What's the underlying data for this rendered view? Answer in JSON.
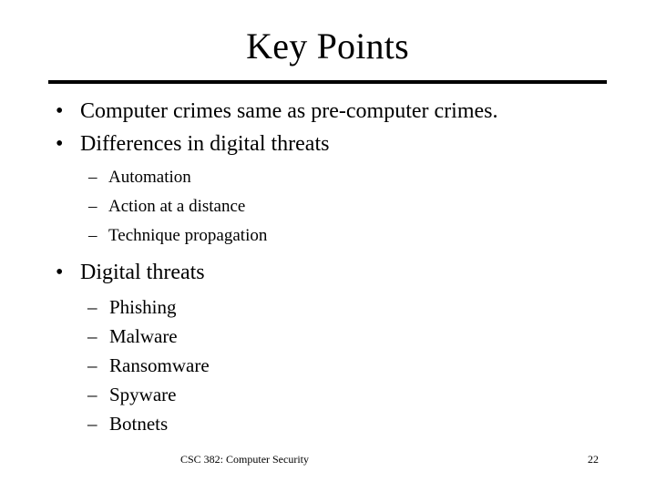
{
  "slide": {
    "title": "Key Points",
    "bullets": [
      {
        "level": 1,
        "marker": "•",
        "text": "Computer crimes same as pre-computer crimes."
      },
      {
        "level": 1,
        "marker": "•",
        "text": "Differences in digital threats"
      },
      {
        "level": 2,
        "marker": "–",
        "text": "Automation"
      },
      {
        "level": 2,
        "marker": "–",
        "text": "Action at a distance"
      },
      {
        "level": 2,
        "marker": "–",
        "text": "Technique propagation"
      },
      {
        "level": 1,
        "marker": "•",
        "text": "Digital threats"
      },
      {
        "level": 2,
        "marker": "–",
        "text": "Phishing"
      },
      {
        "level": 2,
        "marker": "–",
        "text": "Malware"
      },
      {
        "level": 2,
        "marker": "–",
        "text": "Ransomware"
      },
      {
        "level": 2,
        "marker": "–",
        "text": "Spyware"
      },
      {
        "level": 2,
        "marker": "–",
        "text": "Botnets"
      }
    ],
    "footer": {
      "course": "CSC 382: Computer Security",
      "slide_number": "22"
    },
    "colors": {
      "text": "#000000",
      "background": "#ffffff",
      "rule": "#000000"
    }
  }
}
